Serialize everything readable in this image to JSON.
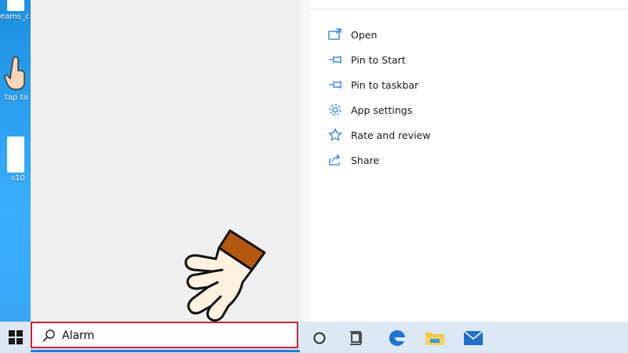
{
  "desktop": {
    "icons": [
      {
        "label": "eams_c"
      },
      {
        "label": "tap ta"
      },
      {
        "label": "s10"
      }
    ]
  },
  "start_menu": {
    "actions": [
      {
        "label": "Open",
        "icon": "open-icon"
      },
      {
        "label": "Pin to Start",
        "icon": "pin-icon"
      },
      {
        "label": "Pin to taskbar",
        "icon": "pin-icon"
      },
      {
        "label": "App settings",
        "icon": "gear-icon"
      },
      {
        "label": "Rate and review",
        "icon": "star-icon"
      },
      {
        "label": "Share",
        "icon": "share-icon"
      }
    ]
  },
  "taskbar": {
    "search_value": "Alarm",
    "icons": [
      "windows-start-icon",
      "search-icon",
      "cortana-icon",
      "task-view-icon",
      "edge-icon",
      "file-explorer-icon",
      "mail-icon"
    ]
  },
  "colors": {
    "accent": "#2b7bd8",
    "highlight_border": "#c8243a",
    "menu_left_bg": "#efefef",
    "taskbar_bg": "#dce8f3"
  }
}
